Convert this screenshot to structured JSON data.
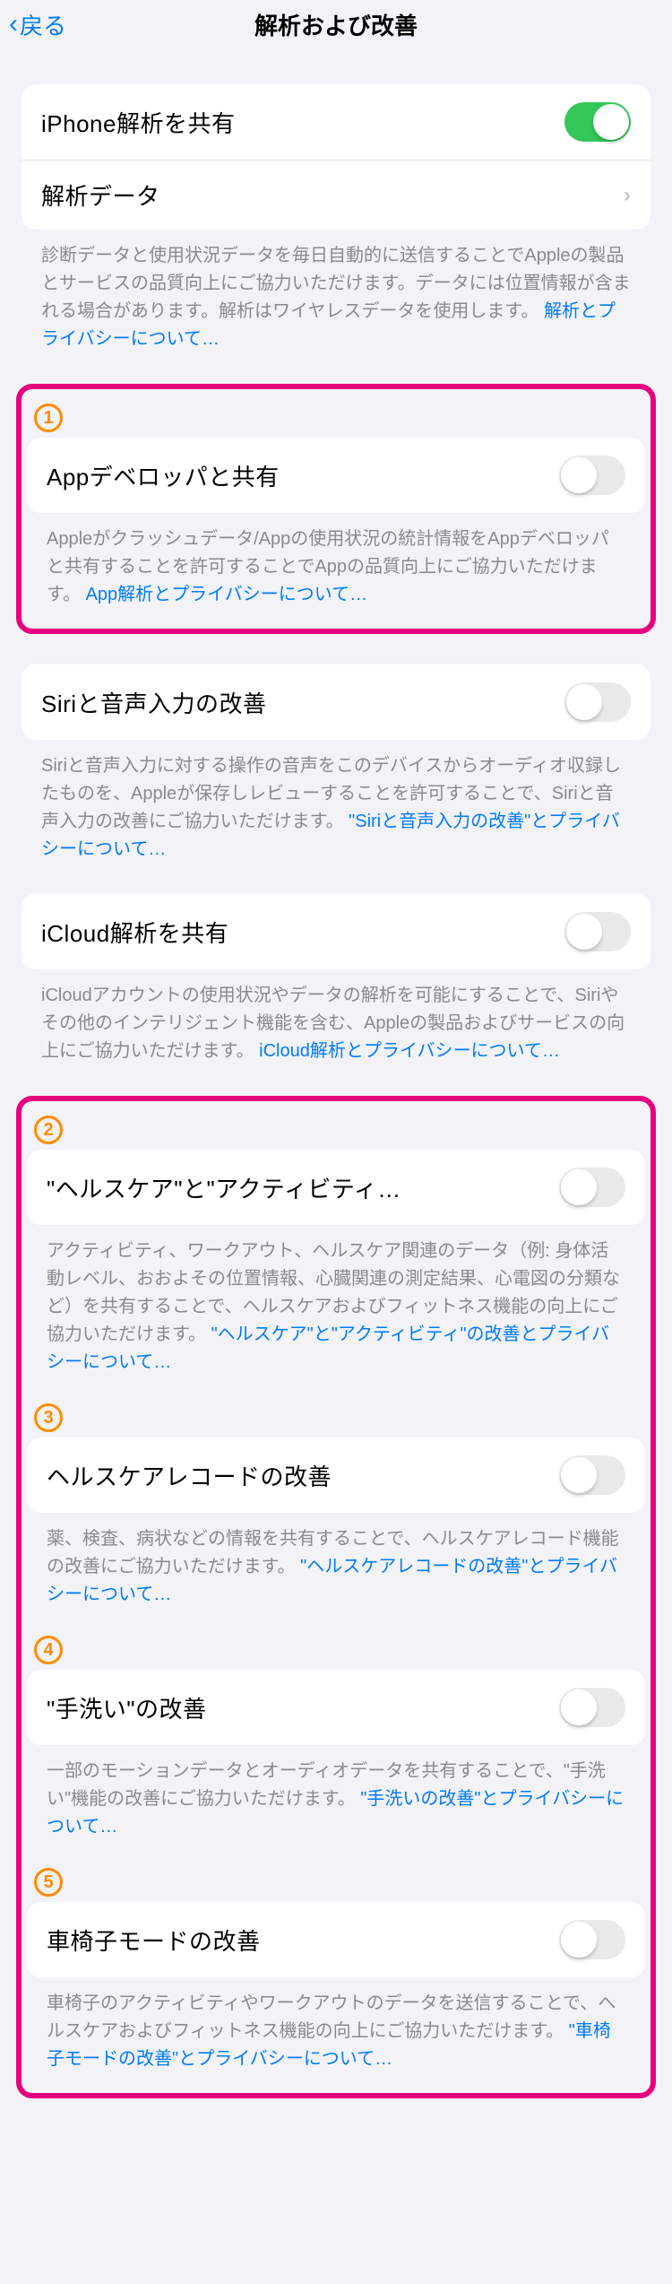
{
  "nav": {
    "back": "戻る",
    "title": "解析および改善"
  },
  "s1": {
    "share_label": "iPhone解析を共有",
    "data_label": "解析データ",
    "footer_a": "診断データと使用状況データを毎日自動的に送信することでAppleの製品とサービスの品質向上にご協力いただけます。データには位置情報が含まれる場合があります。解析はワイヤレスデータを使用します。",
    "footer_link": "解析とプライバシーについて…"
  },
  "box1": {
    "badge": "1",
    "label": "Appデベロッパと共有",
    "footer_a": "Appleがクラッシュデータ/Appの使用状況の統計情報をAppデベロッパと共有することを許可することでAppの品質向上にご協力いただけます。",
    "footer_link": "App解析とプライバシーについて…"
  },
  "s2": {
    "label": "Siriと音声入力の改善",
    "footer_a": "Siriと音声入力に対する操作の音声をこのデバイスからオーディオ収録したものを、Appleが保存しレビューすることを許可することで、Siriと音声入力の改善にご協力いただけます。",
    "footer_link": "\"Siriと音声入力の改善\"とプライバシーについて…"
  },
  "s3": {
    "label": "iCloud解析を共有",
    "footer_a": "iCloudアカウントの使用状況やデータの解析を可能にすることで、Siriやその他のインテリジェント機能を含む、Appleの製品およびサービスの向上にご協力いただけます。",
    "footer_link": "iCloud解析とプライバシーについて…"
  },
  "box2": {
    "g1": {
      "badge": "2",
      "label": "\"ヘルスケア\"と\"アクティビティ…",
      "footer_a": "アクティビティ、ワークアウト、ヘルスケア関連のデータ（例: 身体活動レベル、おおよその位置情報、心臓関連の測定結果、心電図の分類など）を共有することで、ヘルスケアおよびフィットネス機能の向上にご協力いただけます。",
      "footer_link": "\"ヘルスケア\"と\"アクティビティ\"の改善とプライバシーについて…"
    },
    "g2": {
      "badge": "3",
      "label": "ヘルスケアレコードの改善",
      "footer_a": "薬、検査、病状などの情報を共有することで、ヘルスケアレコード機能の改善にご協力いただけます。",
      "footer_link": "\"ヘルスケアレコードの改善\"とプライバシーについて…"
    },
    "g3": {
      "badge": "4",
      "label": "\"手洗い\"の改善",
      "footer_a": "一部のモーションデータとオーディオデータを共有することで、\"手洗い\"機能の改善にご協力いただけます。",
      "footer_link": "\"手洗いの改善\"とプライバシーについて…"
    },
    "g4": {
      "badge": "5",
      "label": "車椅子モードの改善",
      "footer_a": "車椅子のアクティビティやワークアウトのデータを送信することで、ヘルスケアおよびフィットネス機能の向上にご協力いただけます。",
      "footer_link": "\"車椅子モードの改善\"とプライバシーについて…"
    }
  }
}
